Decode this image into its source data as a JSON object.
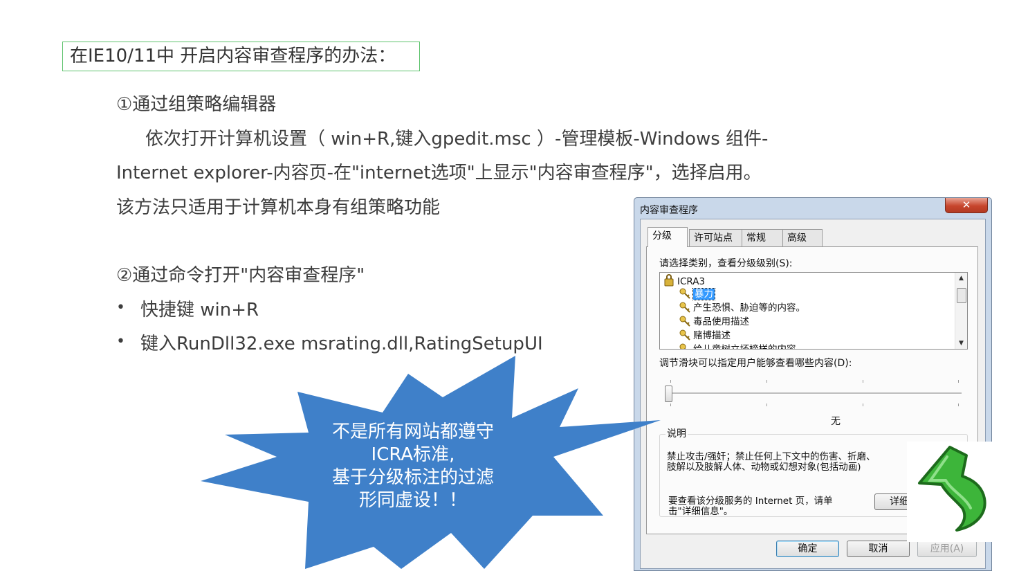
{
  "heading": "在IE10/11中 开启内容审查程序的办法：",
  "method1": {
    "title": "①通过组策略编辑器",
    "line1": "依次打开计算机设置（ win+R,键入gpedit.msc ）-管理模板-Windows  组件-",
    "line2": "Internet  explorer-内容页-在\"internet选项\"上显示\"内容审查程序\"，选择启用。",
    "line3": "该方法只适用于计算机本身有组策略功能"
  },
  "method2": {
    "title": "②通过命令打开\"内容审查程序\"",
    "bullets": [
      "快捷键 win+R",
      "键入RunDll32.exe msrating.dll,RatingSetupUI"
    ],
    "bullet_char": "•"
  },
  "callout": {
    "lines": [
      "不是所有网站都遵守",
      "ICRA标准,",
      "基于分级标注的过滤",
      "形同虚设！！"
    ],
    "color": "#3f80c9"
  },
  "dialog": {
    "title": "内容审查程序",
    "close": "✕",
    "tabs": [
      "分级",
      "许可站点",
      "常规",
      "高级"
    ],
    "active_tab": "分级",
    "category_prompt": "请选择类别，查看分级级别(S):",
    "tree": {
      "root": "ICRA3",
      "items": [
        "暴力",
        "产生恐惧、胁迫等的内容。",
        "毒品使用描述",
        "赌博描述",
        "给儿童树立坏榜样的内容"
      ],
      "selected": "暴力"
    },
    "slider_prompt": "调节滑块可以指定用户能够查看哪些内容(D):",
    "slider_value_label": "无",
    "description_title": "说明",
    "description_text_1": "禁止攻击/强奸；禁止任何上下文中的伤害、折磨、",
    "description_text_2": "肢解以及肢解人体、动物或幻想对象(包括动画)",
    "more_info_1": "要查看该分级服务的 Internet 页，请单",
    "more_info_2": "击\"详细信息\"。",
    "details_button": "详细",
    "ok": "确定",
    "cancel": "取消",
    "apply": "应用(A)"
  },
  "colors": {
    "heading_border": "#5cc26b",
    "callout": "#3f80c9",
    "arrow": "#3db53a"
  },
  "icons": {
    "tree_root": "lock-key-icon",
    "tree_item": "key-icon",
    "overlay": "green-back-arrow-icon"
  }
}
